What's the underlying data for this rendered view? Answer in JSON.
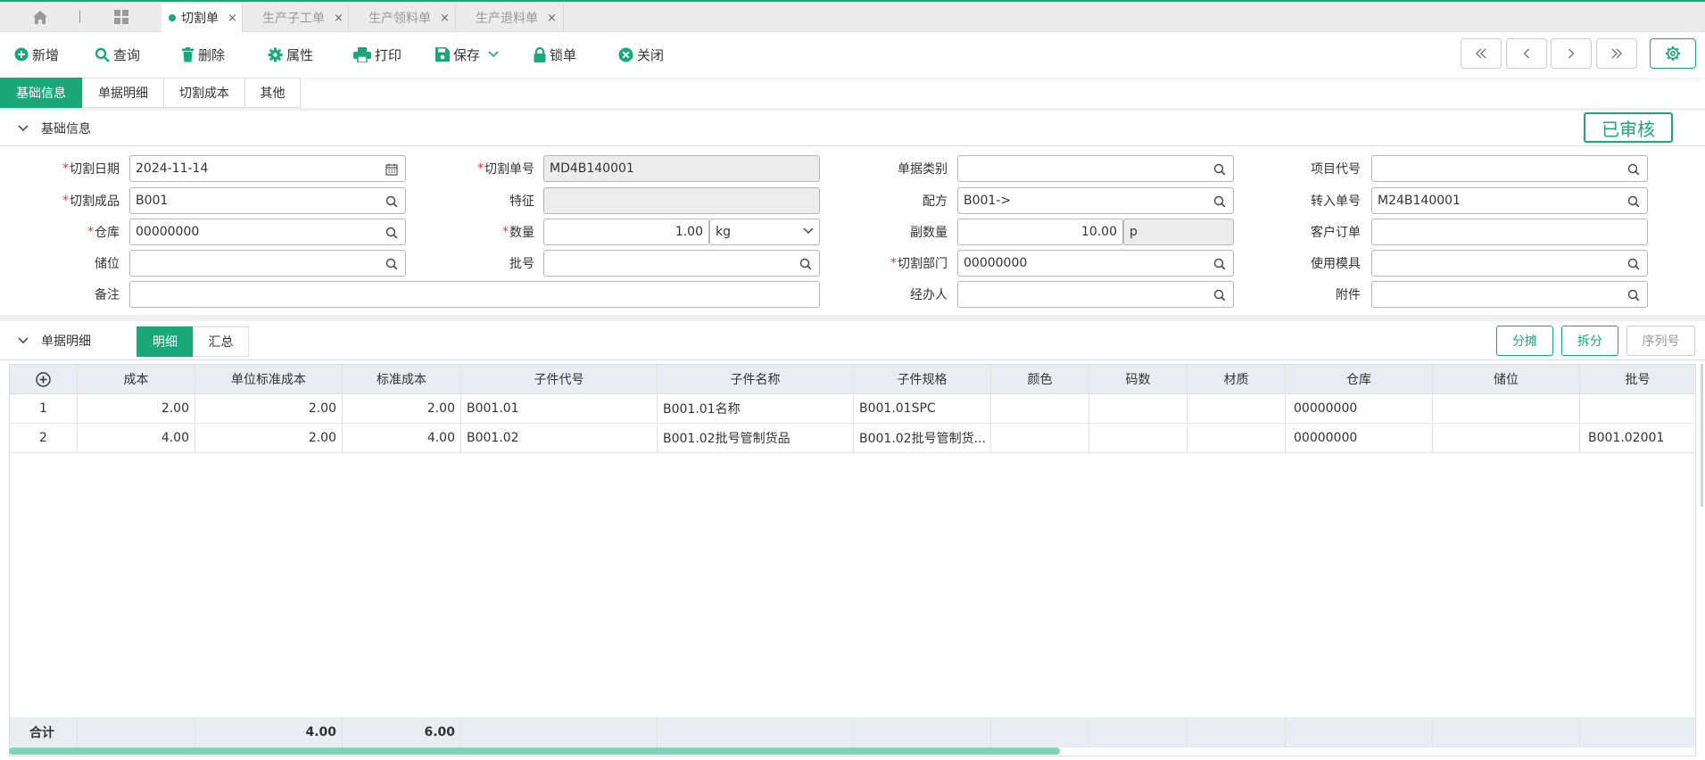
{
  "tabbar": {
    "tabs": [
      {
        "label": "切割单",
        "active": true
      },
      {
        "label": "生产子工单",
        "active": false
      },
      {
        "label": "生产领料单",
        "active": false
      },
      {
        "label": "生产退料单",
        "active": false
      }
    ],
    "close_glyph": "×"
  },
  "toolbar": {
    "new": "新增",
    "query": "查询",
    "delete": "删除",
    "attr": "属性",
    "print": "打印",
    "save": "保存",
    "lock": "锁单",
    "close": "关闭"
  },
  "section_tabs": [
    "基础信息",
    "单据明细",
    "切割成本",
    "其他"
  ],
  "basic": {
    "title": "基础信息",
    "status": "已审核",
    "labels": {
      "cut_date": "切割日期",
      "cut_no": "切割单号",
      "doc_type": "单据类别",
      "project_code": "项目代号",
      "product": "切割成品",
      "feature": "特征",
      "formula": "配方",
      "transfer_no": "转入单号",
      "warehouse": "仓库",
      "qty": "数量",
      "sub_qty": "副数量",
      "customer_order": "客户订单",
      "location": "储位",
      "batch": "批号",
      "dept": "切割部门",
      "mold": "使用模具",
      "remark": "备注",
      "handler": "经办人",
      "attachment": "附件"
    },
    "values": {
      "cut_date": "2024-11-14",
      "cut_no": "MD4B140001",
      "doc_type": "",
      "project_code": "",
      "product": "B001",
      "feature": "",
      "formula": "B001->",
      "transfer_no": "M24B140001",
      "warehouse": "00000000",
      "qty": "1.00",
      "unit": "kg",
      "sub_qty": "10.00",
      "sub_unit": "p",
      "customer_order": "",
      "location": "",
      "batch": "",
      "dept": "00000000",
      "mold": "",
      "remark": "",
      "handler": "",
      "attachment": ""
    }
  },
  "detail": {
    "title": "单据明细",
    "subtabs": [
      "明细",
      "汇总"
    ],
    "buttons": {
      "allocate": "分摊",
      "split": "拆分",
      "serial": "序列号"
    },
    "columns": [
      "成本",
      "单位标准成本",
      "标准成本",
      "子件代号",
      "子件名称",
      "子件规格",
      "颜色",
      "码数",
      "材质",
      "仓库",
      "储位",
      "批号"
    ],
    "rows": [
      {
        "no": "1",
        "cost": "2.00",
        "unit_std": "2.00",
        "std": "2.00",
        "code": "B001.01",
        "name": "B001.01名称",
        "spec": "B001.01SPC",
        "color": "",
        "size": "",
        "material": "",
        "warehouse": "00000000",
        "location": "",
        "batch": ""
      },
      {
        "no": "2",
        "cost": "4.00",
        "unit_std": "2.00",
        "std": "4.00",
        "code": "B001.02",
        "name": "B001.02批号管制货品",
        "spec": "B001.02批号管制货...",
        "color": "",
        "size": "",
        "material": "",
        "warehouse": "00000000",
        "location": "",
        "batch": "B001.02001"
      }
    ],
    "footer": {
      "label": "合计",
      "unit_std": "4.00",
      "std": "6.00"
    }
  },
  "colors": {
    "accent": "#1aa878",
    "required": "#e53935"
  },
  "icons": [
    "home-icon",
    "apps-grid-icon",
    "plus-circle-icon",
    "search-icon",
    "trash-icon",
    "gear-icon",
    "printer-icon",
    "save-icon",
    "lock-icon",
    "close-circle-icon",
    "calendar-icon",
    "chevron-down-icon"
  ]
}
